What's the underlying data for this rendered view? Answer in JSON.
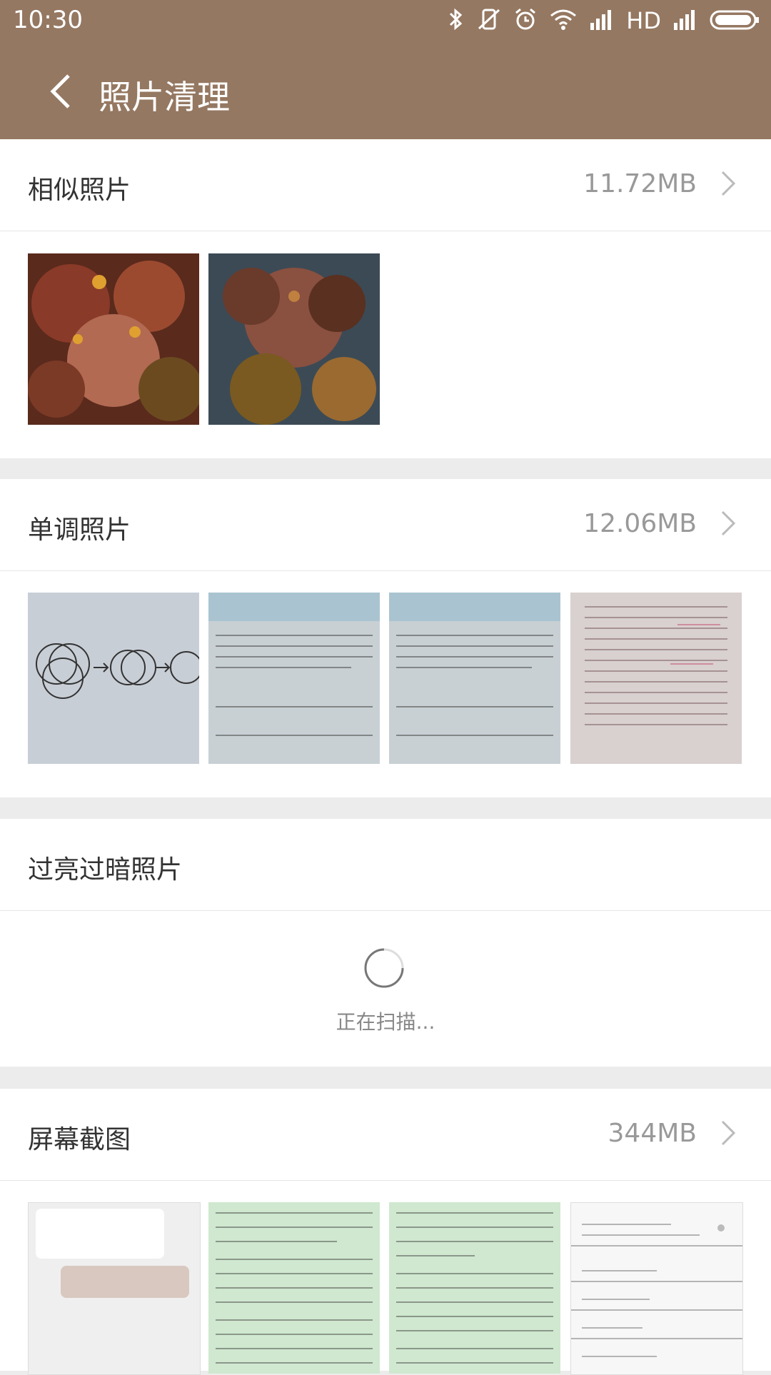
{
  "status": {
    "time": "10:30",
    "network": "HD"
  },
  "appbar": {
    "title": "照片清理",
    "back_icon": "back-arrow-icon"
  },
  "sections": {
    "similar": {
      "title": "相似照片",
      "size": "11.72MB"
    },
    "monotone": {
      "title": "单调照片",
      "size": "12.06MB"
    },
    "exposure": {
      "title": "过亮过暗照片",
      "scanning_text": "正在扫描..."
    },
    "screenshots": {
      "title": "屏幕截图",
      "size": "344MB"
    }
  },
  "colors": {
    "appbar": "#957862",
    "divider": "#ececec",
    "text_primary": "#333333",
    "text_secondary": "#999999"
  }
}
